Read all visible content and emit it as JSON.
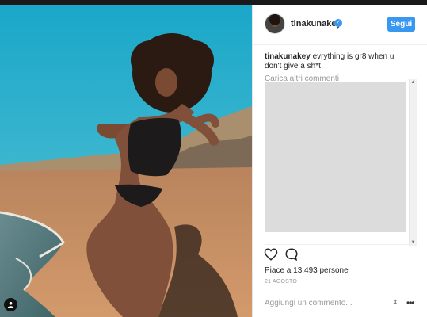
{
  "post": {
    "username": "tinakunakey",
    "follow_label": "Segui",
    "caption_user": "tinakunakey",
    "caption_text": " evrything is gr8 when u don't give a sh*t",
    "load_more_comments": "Carica altri commenti",
    "likes_text": "Piace a 13.493 persone",
    "date_text": "21 AGOSTO",
    "add_comment_placeholder": "Aggiungi un commento..."
  },
  "icons": {
    "verified": "verified-badge-icon",
    "heart": "heart-icon",
    "comment": "comment-bubble-icon",
    "more": "more-options-icon",
    "user_tag": "user-tag-icon"
  },
  "colors": {
    "accent": "#3897f0",
    "text": "#262626",
    "muted": "#999999",
    "comments_placeholder": "#dcdcdc"
  }
}
